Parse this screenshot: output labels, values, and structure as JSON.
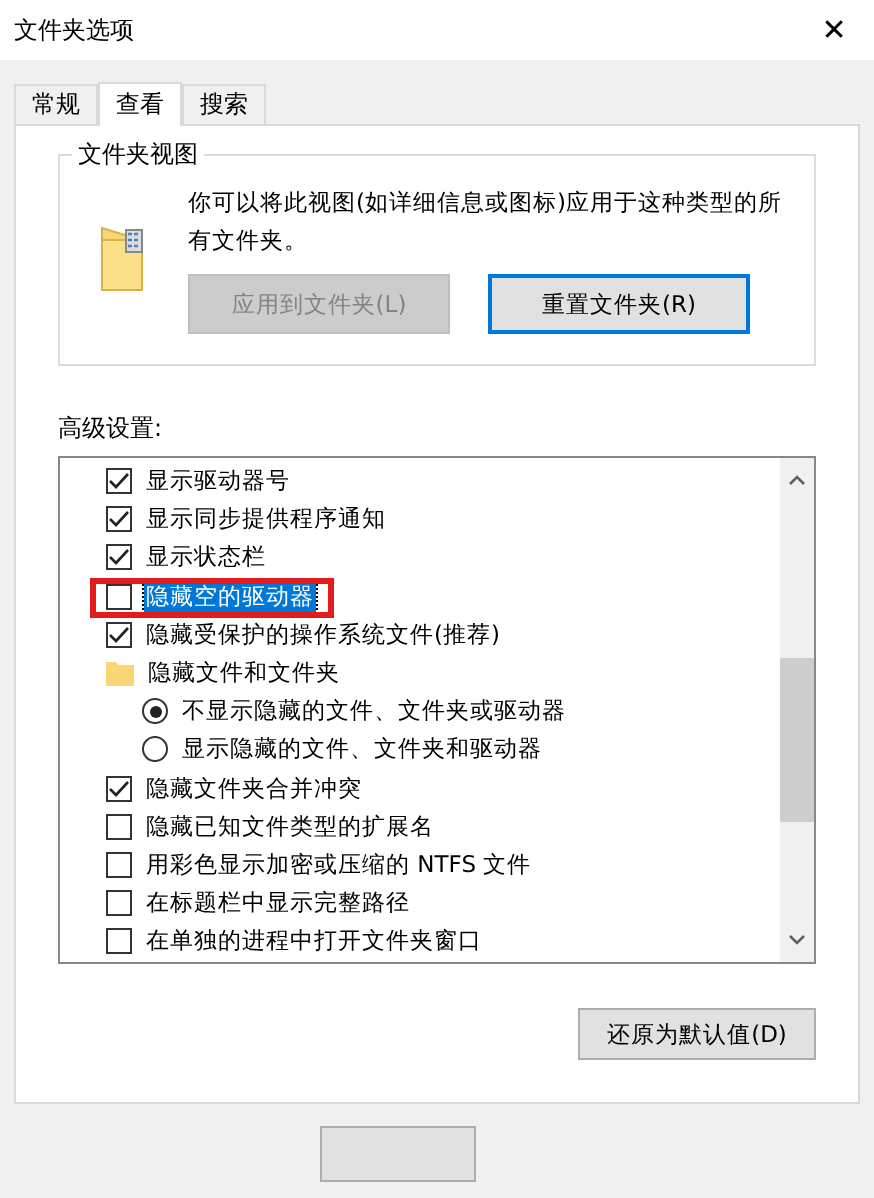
{
  "window": {
    "title": "文件夹选项",
    "close": "✕"
  },
  "tabs": [
    {
      "label": "常规",
      "selected": false
    },
    {
      "label": "查看",
      "selected": true
    },
    {
      "label": "搜索",
      "selected": false
    }
  ],
  "folder_views": {
    "title": "文件夹视图",
    "description": "你可以将此视图(如详细信息或图标)应用于这种类型的所有文件夹。",
    "buttons": [
      {
        "label": "应用到文件夹(L)",
        "disabled": true,
        "focused": false
      },
      {
        "label": "重置文件夹(R)",
        "disabled": false,
        "focused": true
      }
    ]
  },
  "advanced": {
    "label": "高级设置:",
    "items": [
      {
        "kind": "checkbox",
        "label": "显示驱动器号",
        "checked": true,
        "selected": false
      },
      {
        "kind": "checkbox",
        "label": "显示同步提供程序通知",
        "checked": true,
        "selected": false
      },
      {
        "kind": "checkbox",
        "label": "显示状态栏",
        "checked": true,
        "selected": false
      },
      {
        "kind": "checkbox",
        "label": "隐藏空的驱动器",
        "checked": false,
        "selected": true
      },
      {
        "kind": "checkbox",
        "label": "隐藏受保护的操作系统文件(推荐)",
        "checked": true,
        "selected": false
      },
      {
        "kind": "folder",
        "label": "隐藏文件和文件夹",
        "selected": false,
        "children": [
          {
            "kind": "radio",
            "label": "不显示隐藏的文件、文件夹或驱动器",
            "checked": true,
            "selected": false
          },
          {
            "kind": "radio",
            "label": "显示隐藏的文件、文件夹和驱动器",
            "checked": false,
            "selected": false
          }
        ]
      },
      {
        "kind": "checkbox",
        "label": "隐藏文件夹合并冲突",
        "checked": true,
        "selected": false
      },
      {
        "kind": "checkbox",
        "label": "隐藏已知文件类型的扩展名",
        "checked": false,
        "selected": false
      },
      {
        "kind": "checkbox",
        "label": "用彩色显示加密或压缩的 NTFS 文件",
        "checked": false,
        "selected": false
      },
      {
        "kind": "checkbox",
        "label": "在标题栏中显示完整路径",
        "checked": false,
        "selected": false
      },
      {
        "kind": "checkbox",
        "label": "在单独的进程中打开文件夹窗口",
        "checked": false,
        "selected": false
      }
    ]
  },
  "restore_button": "还原为默认值(D)"
}
